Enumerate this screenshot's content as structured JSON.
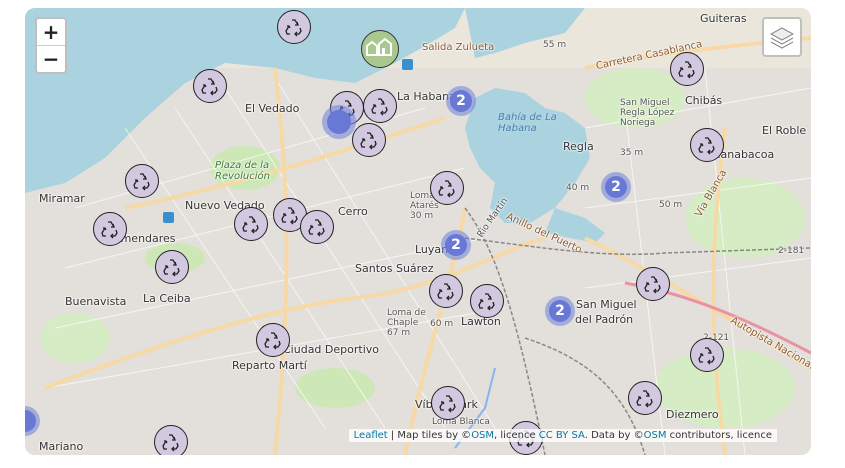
{
  "controls": {
    "zoom_in": "+",
    "zoom_out": "−"
  },
  "attribution": {
    "leaflet": "Leaflet",
    "sep1": " | Map tiles by ©",
    "osm1": "OSM",
    "licence": ", licence ",
    "ccbysa": "CC BY SA",
    "data": ". Data by ©",
    "osm2": "OSM",
    "tail": " contributors, licence"
  },
  "place_labels": [
    {
      "text": "Guiteras",
      "cls": "big"
    },
    {
      "text": "La Habana",
      "cls": "big"
    },
    {
      "text": "El Vedado",
      "cls": "big"
    },
    {
      "text": "Chibás",
      "cls": "big"
    },
    {
      "text": "Regla",
      "cls": "big"
    },
    {
      "text": "El Roble",
      "cls": "big"
    },
    {
      "text": "Guanabacoa",
      "cls": "big"
    },
    {
      "text": "Nuevo Vedado",
      "cls": "big"
    },
    {
      "text": "Cerro",
      "cls": "big"
    },
    {
      "text": "Miramar",
      "cls": "big"
    },
    {
      "text": "Almendares",
      "cls": "big"
    },
    {
      "text": "Luyanó",
      "cls": "big"
    },
    {
      "text": "Santos Suárez",
      "cls": "big"
    },
    {
      "text": "Buenavista",
      "cls": "big"
    },
    {
      "text": "La Ceiba",
      "cls": "big"
    },
    {
      "text": "San Miguel",
      "cls": "big"
    },
    {
      "text": "del Padrón",
      "cls": "big"
    },
    {
      "text": "Lawton",
      "cls": "big"
    },
    {
      "text": "Ciudad Deportivo",
      "cls": "big"
    },
    {
      "text": "Reparto Martí",
      "cls": "big"
    },
    {
      "text": "Víbora Park",
      "cls": "big"
    },
    {
      "text": "Diezmero",
      "cls": "big"
    },
    {
      "text": "Mariano",
      "cls": "big"
    },
    {
      "text": "Bahía de La Habana",
      "cls": "ital"
    },
    {
      "text": "Salida Zulueta",
      "cls": "rd"
    },
    {
      "text": "Plaza de la Revolución",
      "cls": "green"
    },
    {
      "text": "Carretera Casablanca",
      "cls": "rd"
    },
    {
      "text": "Vía Blanca",
      "cls": "rd"
    },
    {
      "text": "Autopista Nacional",
      "cls": "rd"
    },
    {
      "text": "Anillo del Puerto",
      "cls": "rd"
    },
    {
      "text": "Rio Martín",
      "cls": "sm"
    },
    {
      "text": "Loma de Chaple 67 m",
      "cls": "sm"
    },
    {
      "text": "Loma Atarés 30 m",
      "cls": "sm"
    },
    {
      "text": "San Miguel Regla López Noriega",
      "cls": "sm"
    },
    {
      "text": "55 m",
      "cls": "sm"
    },
    {
      "text": "35 m",
      "cls": "sm"
    },
    {
      "text": "40 m",
      "cls": "sm"
    },
    {
      "text": "50 m",
      "cls": "sm"
    },
    {
      "text": "60 m",
      "cls": "sm"
    },
    {
      "text": "2-181",
      "cls": "sm"
    },
    {
      "text": "2-121",
      "cls": "sm"
    },
    {
      "text": "Loma Blanca",
      "cls": "sm"
    }
  ],
  "clusters": [
    {
      "count": "2"
    },
    {
      "count": "2"
    },
    {
      "count": "2"
    },
    {
      "count": "2"
    },
    {
      "count": ""
    }
  ],
  "marker_icon": "recycling-icon",
  "marker_count": 24,
  "layers_icon": "layers-icon",
  "house_icon": "houses-icon",
  "colors": {
    "water": "#aad3df",
    "land": "#f2efe9",
    "residential": "#e0dfdf",
    "park": "#c8e6b0",
    "road_major": "#f7d9a8",
    "marker_fill": "#d2c9e1",
    "cluster": "#6878d4"
  }
}
